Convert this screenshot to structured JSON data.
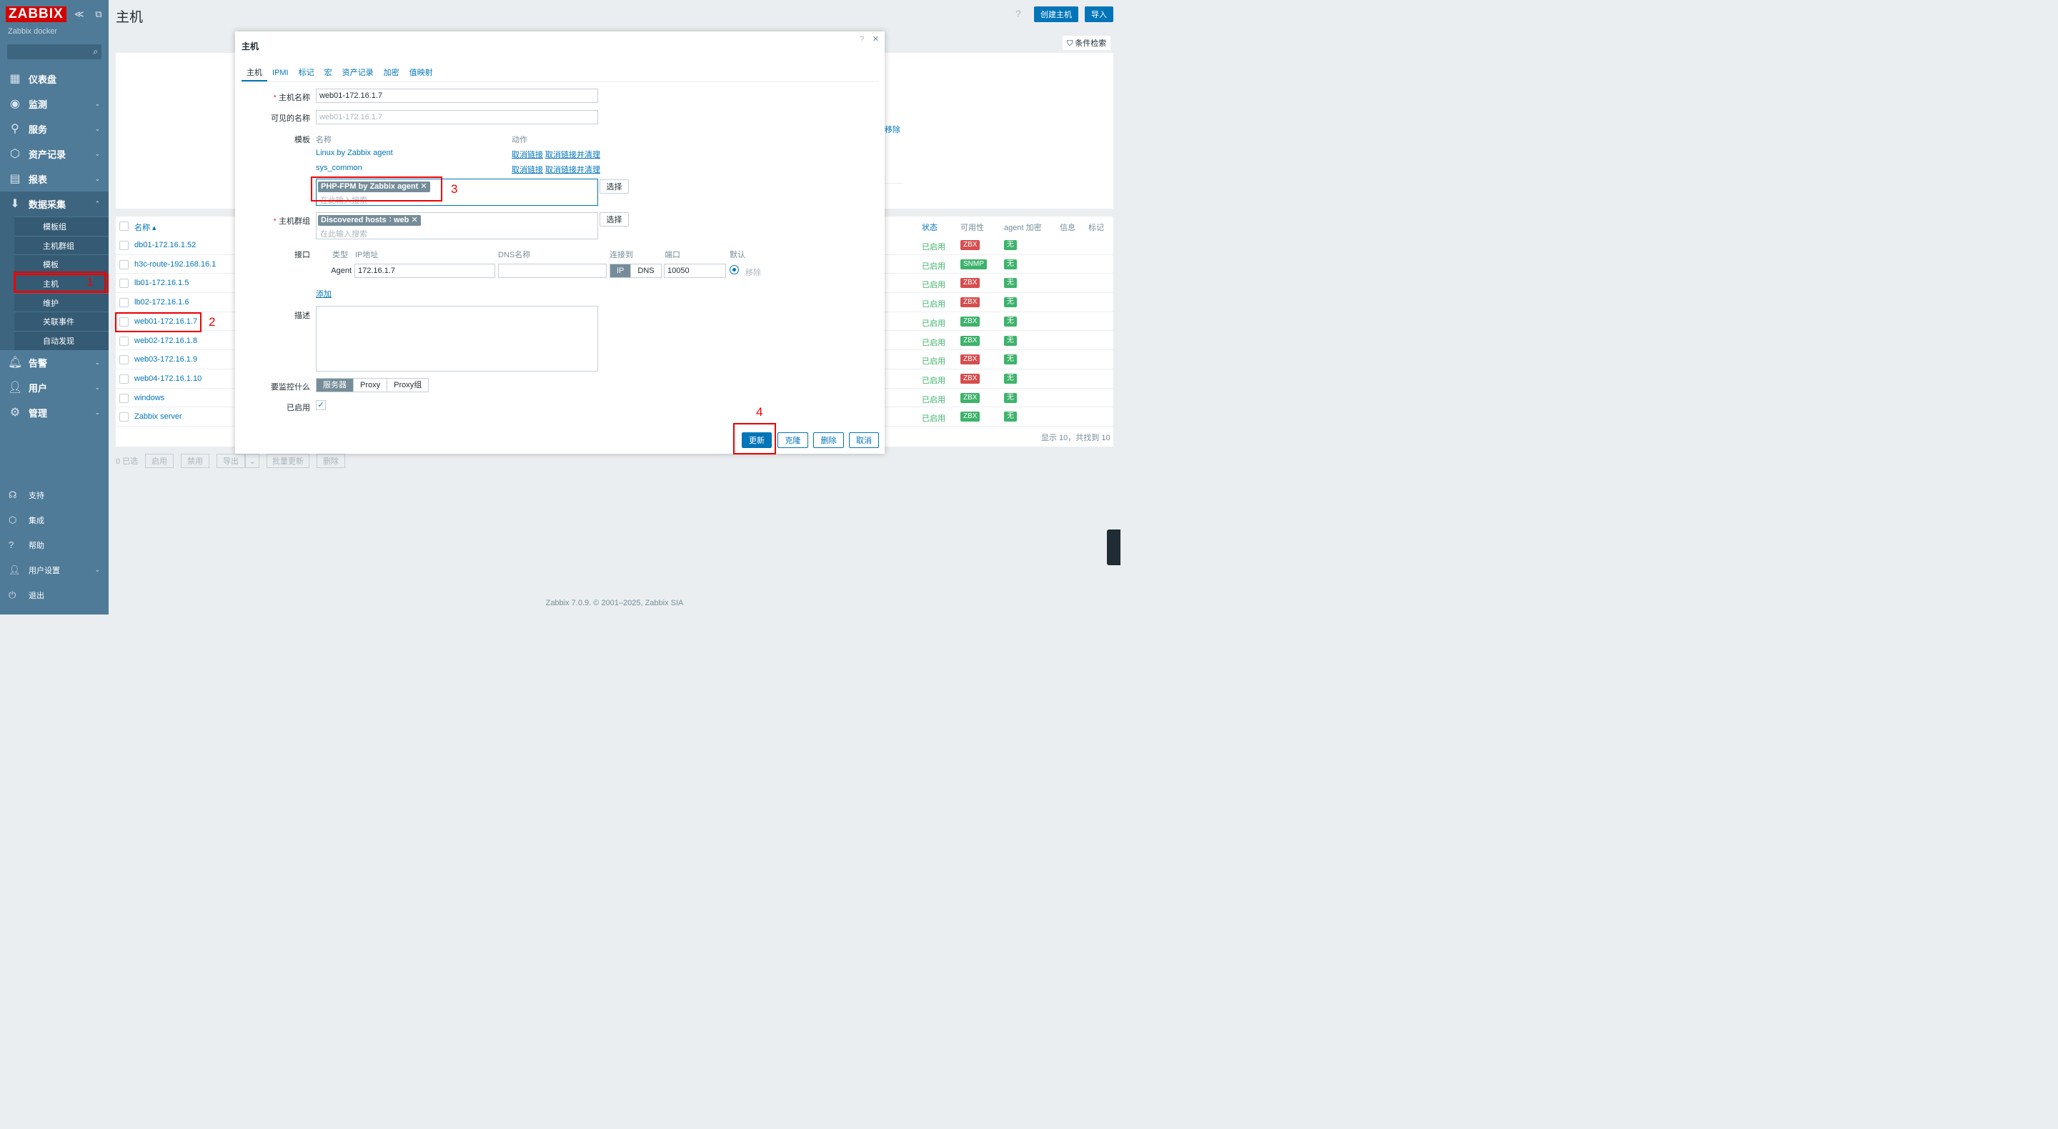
{
  "app": {
    "logo": "ZABBIX",
    "instance": "Zabbix docker",
    "collapse_icons": "≪ ⧉"
  },
  "sidebar": {
    "items": [
      {
        "label": "仪表盘",
        "icon": "dashboard-icon",
        "glyph": "▦",
        "chev": ""
      },
      {
        "label": "监测",
        "icon": "monitor-icon",
        "glyph": "◉",
        "chev": "⌄"
      },
      {
        "label": "服务",
        "icon": "services-icon",
        "glyph": "⚲",
        "chev": "⌄"
      },
      {
        "label": "资产记录",
        "icon": "inventory-icon",
        "glyph": "⬡",
        "chev": "⌄"
      },
      {
        "label": "报表",
        "icon": "reports-icon",
        "glyph": "▤",
        "chev": "⌄"
      },
      {
        "label": "数据采集",
        "icon": "data-collection-icon",
        "glyph": "⬇",
        "chev": "⌃"
      }
    ],
    "subitems": [
      "模板组",
      "主机群组",
      "模板",
      "主机",
      "维护",
      "关联事件",
      "自动发现"
    ],
    "items2": [
      {
        "label": "告警",
        "icon": "alerts-icon",
        "glyph": "🔔︎",
        "chev": "⌄"
      },
      {
        "label": "用户",
        "icon": "users-icon",
        "glyph": "👤︎",
        "chev": "⌄"
      },
      {
        "label": "管理",
        "icon": "admin-icon",
        "glyph": "⚙",
        "chev": "⌄"
      }
    ],
    "bottom": [
      {
        "label": "支持",
        "icon": "support-icon",
        "glyph": "☊",
        "chev": ""
      },
      {
        "label": "集成",
        "icon": "integrations-icon",
        "glyph": "⬡",
        "chev": ""
      },
      {
        "label": "帮助",
        "icon": "help-icon",
        "glyph": "?",
        "chev": ""
      },
      {
        "label": "用户设置",
        "icon": "user-settings-icon",
        "glyph": "👤︎",
        "chev": "⌄"
      },
      {
        "label": "退出",
        "icon": "signout-icon",
        "glyph": "⏻",
        "chev": ""
      }
    ]
  },
  "header": {
    "title": "主机",
    "help": "?",
    "create_btn": "创建主机",
    "import_btn": "导入",
    "filter": "条件检索"
  },
  "hosts_table": {
    "columns": {
      "name": "名称 ▴",
      "status": "状态",
      "availability": "可用性",
      "encryption": "agent 加密",
      "info": "信息",
      "tags": "标记"
    },
    "rows": [
      {
        "name": "db01-172.16.1.52",
        "status": "已启用",
        "avail": "ZBX",
        "avail_color": "#d64e4e",
        "enc": "无"
      },
      {
        "name": "h3c-route-192.168.16.1",
        "status": "已启用",
        "avail": "SNMP",
        "avail_color": "#3db36b",
        "enc": "无"
      },
      {
        "name": "lb01-172.16.1.5",
        "status": "已启用",
        "avail": "ZBX",
        "avail_color": "#d64e4e",
        "enc": "无"
      },
      {
        "name": "lb02-172.16.1.6",
        "status": "已启用",
        "avail": "ZBX",
        "avail_color": "#d64e4e",
        "enc": "无"
      },
      {
        "name": "web01-172.16.1.7",
        "status": "已启用",
        "avail": "ZBX",
        "avail_color": "#3db36b",
        "enc": "无"
      },
      {
        "name": "web02-172.16.1.8",
        "status": "已启用",
        "avail": "ZBX",
        "avail_color": "#3db36b",
        "enc": "无"
      },
      {
        "name": "web03-172.16.1.9",
        "status": "已启用",
        "avail": "ZBX",
        "avail_color": "#d64e4e",
        "enc": "无"
      },
      {
        "name": "web04-172.16.1.10",
        "status": "已启用",
        "avail": "ZBX",
        "avail_color": "#d64e4e",
        "enc": "无"
      },
      {
        "name": "windows",
        "status": "已启用",
        "avail": "ZBX",
        "avail_color": "#3db36b",
        "enc": "无"
      },
      {
        "name": "Zabbix server",
        "status": "已启用",
        "avail": "ZBX",
        "avail_color": "#3db36b",
        "enc": "无"
      }
    ],
    "summary": "显示 10，共找到 10",
    "partial_remove": "移除",
    "selected": "0 已选",
    "mass": [
      "启用",
      "禁用",
      "导出",
      "⌄",
      "批量更新",
      "删除"
    ]
  },
  "modal": {
    "title": "主机",
    "help": "?",
    "close": "×",
    "tabs": [
      "主机",
      "IPMI",
      "标记",
      "宏",
      "资产记录",
      "加密",
      "值映射"
    ],
    "host_name_label": "主机名称",
    "host_name": "web01-172.16.1.7",
    "visible_name_label": "可见的名称",
    "visible_name_placeholder": "web01-172.16.1.7",
    "templates_label": "模板",
    "tpl_col_name": "名称",
    "tpl_col_action": "动作",
    "templates": [
      {
        "name": "Linux by Zabbix agent",
        "unlink": "取消链接",
        "unlink_clear": "取消链接并清理"
      },
      {
        "name": "sys_common",
        "unlink": "取消链接",
        "unlink_clear": "取消链接并清理"
      }
    ],
    "new_template_chip": "PHP-FPM by Zabbix agent ✕",
    "search_placeholder": "在此输入搜索",
    "select_btn": "选择",
    "groups_label": "主机群组",
    "groups": [
      "Discovered hosts ✕",
      "web ✕"
    ],
    "interfaces_label": "接口",
    "if_cols": {
      "type": "类型",
      "ip": "IP地址",
      "dns": "DNS名称",
      "connect": "连接到",
      "port": "端口",
      "default": "默认"
    },
    "interface": {
      "type": "Agent",
      "ip": "172.16.1.7",
      "dns": "",
      "ip_btn": "IP",
      "dns_btn": "DNS",
      "port": "10050",
      "remove": "移除"
    },
    "add_link": "添加",
    "description_label": "描述",
    "monitored_by_label": "要监控什么",
    "monitored_by": [
      "服务器",
      "Proxy",
      "Proxy组"
    ],
    "enabled_label": "已启用",
    "enabled_check": "✓",
    "buttons": {
      "update": "更新",
      "clone": "克隆",
      "delete": "删除",
      "cancel": "取消"
    }
  },
  "annotations": [
    "1",
    "2",
    "3",
    "4"
  ],
  "footer": "Zabbix 7.0.9. © 2001–2025, Zabbix SIA"
}
